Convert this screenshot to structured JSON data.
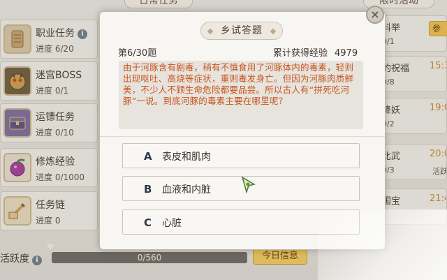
{
  "tabs": {
    "daily": "日常任务",
    "limited": "限时活动"
  },
  "tasks": [
    {
      "name": "职业任务",
      "progress": "进度 6/20",
      "has_info": true,
      "icon": "scroll-icon"
    },
    {
      "name": "迷宫BOSS",
      "progress": "进度 0/1",
      "has_info": false,
      "icon": "demon-mask-icon"
    },
    {
      "name": "运镖任务",
      "progress": "进度 0/10",
      "has_info": false,
      "icon": "treasure-chest-icon"
    },
    {
      "name": "修炼经验",
      "progress": "进度 0/1000",
      "has_info": false,
      "icon": "fruit-icon"
    },
    {
      "name": "任务链",
      "progress": "进度 0",
      "has_info": false,
      "icon": "sword-scroll-icon"
    }
  ],
  "limited": [
    {
      "name": "科举",
      "sub": "0/1",
      "time": "",
      "tag": "",
      "button": "参"
    },
    {
      "name": "的祝福",
      "sub": "0/8",
      "time": "15:3",
      "tag": ""
    },
    {
      "name": "降妖",
      "sub": "0/2",
      "time": "19:0",
      "tag": ""
    },
    {
      "name": "比武",
      "sub": "0/3",
      "time": "20:0",
      "tag": "活跃"
    },
    {
      "name": "国宝",
      "sub": "",
      "time": "21:4",
      "tag": ""
    }
  ],
  "activity": {
    "label": "活跃度",
    "value": "0/560",
    "progress": 0,
    "info": "i"
  },
  "today_button": "今日信息",
  "dialog": {
    "title": "乡试答题",
    "counter": "第6/30题",
    "exp_label": "累计获得经验",
    "exp_value": "4979",
    "question": "由于河豚含有剧毒，稍有不慎食用了河豚体内的毒素，轻则出现呕吐、高烧等症状，重则毒发身亡。但因为河豚肉质鲜美，不少人不顾生命危险都要品尝。所以古人有“拼死吃河豚”一说。到底河豚的毒素主要在哪里呢？",
    "options": [
      {
        "letter": "A",
        "text": "表皮和肌肉"
      },
      {
        "letter": "B",
        "text": "血液和内脏"
      },
      {
        "letter": "C",
        "text": "心脏"
      }
    ],
    "close": "×"
  },
  "colors": {
    "question_text": "#c8541e",
    "accent_gold": "#f5cc5a"
  }
}
